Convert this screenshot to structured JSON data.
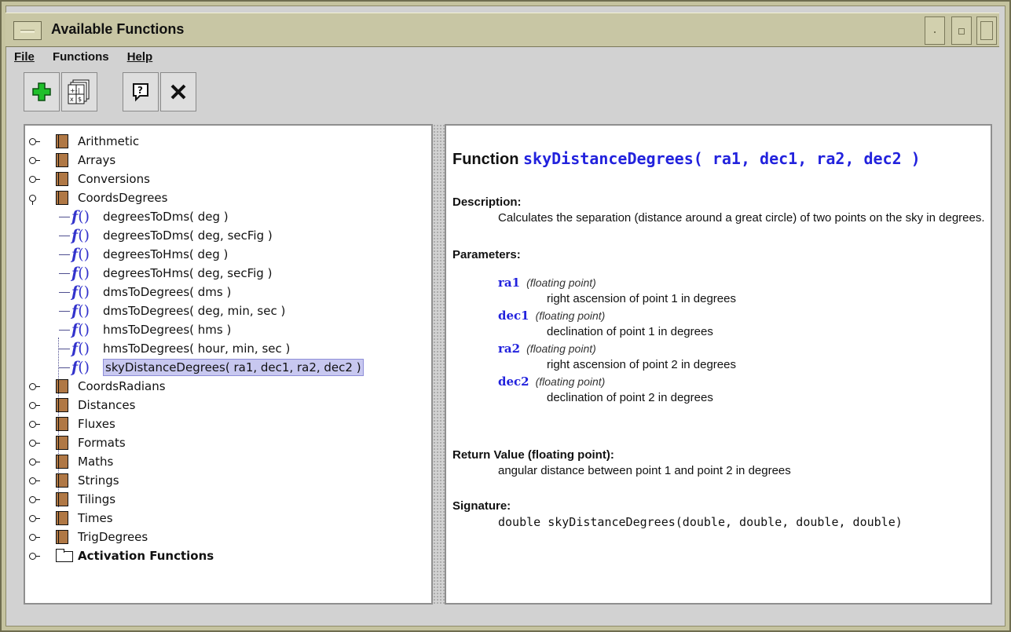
{
  "window": {
    "title": "Available Functions"
  },
  "menu": [
    {
      "label": "File",
      "mnemonic": "F"
    },
    {
      "label": "Functions",
      "mnemonic": ""
    },
    {
      "label": "Help",
      "mnemonic": "H"
    }
  ],
  "toolbar": {
    "buttons": [
      {
        "icon": "add-icon"
      },
      {
        "icon": "calculator-icon"
      },
      {
        "icon": "help-icon"
      },
      {
        "icon": "close-icon"
      }
    ]
  },
  "tree": {
    "categories_before": [
      "Arithmetic",
      "Arrays",
      "Conversions"
    ],
    "expanded": {
      "label": "CoordsDegrees",
      "functions": [
        "degreesToDms( deg )",
        "degreesToDms( deg, secFig )",
        "degreesToHms( deg )",
        "degreesToHms( deg, secFig )",
        "dmsToDegrees( dms )",
        "dmsToDegrees( deg, min, sec )",
        "hmsToDegrees( hms )",
        "hmsToDegrees( hour, min, sec )",
        "skyDistanceDegrees( ra1, dec1, ra2, dec2 )"
      ],
      "selected_index": 8
    },
    "categories_after": [
      "CoordsRadians",
      "Distances",
      "Fluxes",
      "Formats",
      "Maths",
      "Strings",
      "Tilings",
      "Times",
      "TrigDegrees"
    ],
    "activation": "Activation Functions",
    "fn_symbol": "f",
    "fn_parens": "()"
  },
  "doc": {
    "heading_prefix": "Function",
    "heading_name": "skyDistanceDegrees( ra1, dec1, ra2, dec2 )",
    "description_label": "Description:",
    "description": "Calculates the separation (distance around a great circle) of two points on the sky in degrees.",
    "parameters_label": "Parameters:",
    "parameters": [
      {
        "name": "ra1",
        "type": "(floating point)",
        "desc": "right ascension of point 1 in degrees"
      },
      {
        "name": "dec1",
        "type": "(floating point)",
        "desc": "declination of point 1 in degrees"
      },
      {
        "name": "ra2",
        "type": "(floating point)",
        "desc": "right ascension of point 2 in degrees"
      },
      {
        "name": "dec2",
        "type": "(floating point)",
        "desc": "declination of point 2 in degrees"
      }
    ],
    "return_label": "Return Value (floating point):",
    "return_desc": "angular distance between point 1 and point 2 in degrees",
    "signature_label": "Signature:",
    "signature": "double skyDistanceDegrees(double, double, double, double)"
  }
}
